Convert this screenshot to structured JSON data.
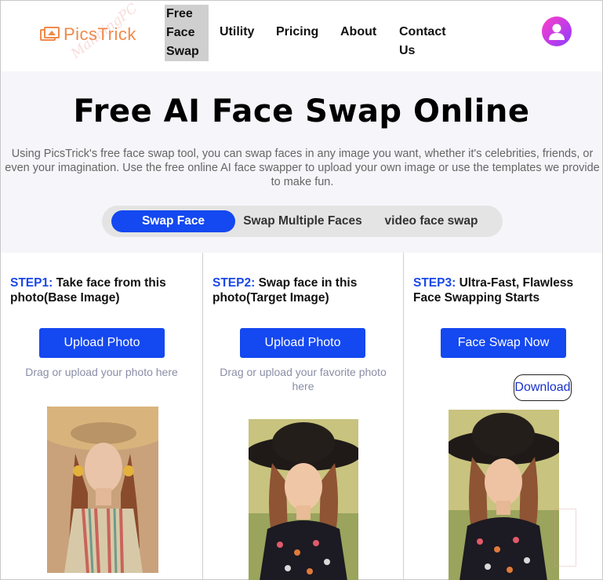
{
  "brand": {
    "logo_text": "PicsTrick",
    "accent": "#f08a4b"
  },
  "watermark": {
    "text": "ManningPC"
  },
  "nav": {
    "free_face_swap": [
      "Free",
      "Face",
      "Swap"
    ],
    "utility": "Utility",
    "pricing": "Pricing",
    "about": "About",
    "contact": "Contact Us"
  },
  "hero": {
    "title": "Free AI Face Swap Online",
    "description": "Using PicsTrick's free face swap tool, you can swap faces in any image you want, whether it's celebrities, friends, or even your imagination. Use the free online AI face swapper to upload your own image or use the templates we provide to make fun.",
    "tabs": [
      {
        "label": "Swap Face",
        "active": true
      },
      {
        "label": "Swap Multiple Faces",
        "active": false
      },
      {
        "label": "video face swap",
        "active": false
      }
    ]
  },
  "steps": [
    {
      "num": "STEP1:",
      "text": "Take face from this photo(Base Image)",
      "button": "Upload Photo",
      "hint": "Drag or upload your photo here"
    },
    {
      "num": "STEP2:",
      "text": "Swap face in this photo(Target Image)",
      "button": "Upload Photo",
      "hint": "Drag or upload your favorite photo here"
    },
    {
      "num": "STEP3:",
      "text": "Ultra-Fast, Flawless Face Swapping Starts",
      "button": "Face Swap Now",
      "download": "Download"
    }
  ],
  "colors": {
    "primary": "#1448f0",
    "step_num": "#1a47e8",
    "hero_bg": "#f5f5fa"
  }
}
